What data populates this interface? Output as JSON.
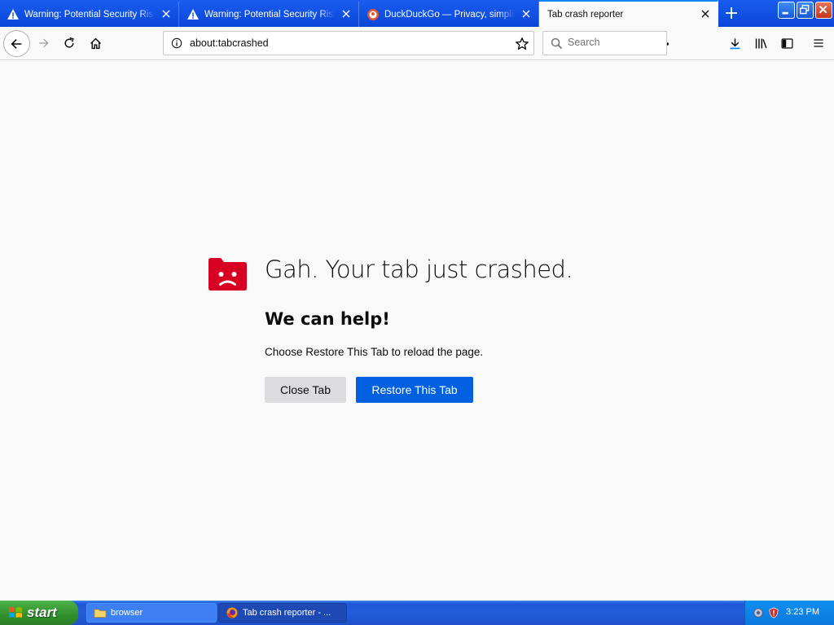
{
  "tabs": [
    {
      "title": "Warning: Potential Security Risk Ahead",
      "icon": "warning-icon",
      "active": false
    },
    {
      "title": "Warning: Potential Security Risk Ahead",
      "icon": "warning-icon",
      "active": false
    },
    {
      "title": "DuckDuckGo — Privacy, simplified.",
      "icon": "duckduckgo-icon",
      "active": false
    },
    {
      "title": "Tab crash reporter",
      "icon": "",
      "active": true
    }
  ],
  "navbar": {
    "url": "about:tabcrashed",
    "search_placeholder": "Search"
  },
  "crash_page": {
    "title": "Gah. Your tab just crashed.",
    "heading": "We can help!",
    "message": "Choose Restore This Tab to reload the page.",
    "close_tab_label": "Close Tab",
    "restore_tab_label": "Restore This Tab"
  },
  "taskbar": {
    "start_label": "start",
    "items": [
      {
        "label": "browser",
        "icon": "folder-icon"
      },
      {
        "label": "Tab crash reporter - ...",
        "icon": "firefox-icon"
      }
    ],
    "clock": "3:23 PM"
  },
  "colors": {
    "accent": "#0060df",
    "crash_icon": "#d70022",
    "tabstrip": "#0a4de8"
  }
}
